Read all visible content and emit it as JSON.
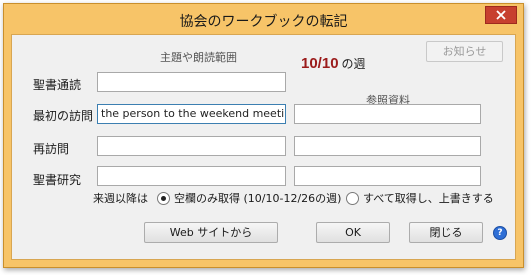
{
  "window": {
    "title": "協会のワークブックの転記"
  },
  "header": {
    "main_heading": "主題や朗読範囲",
    "week_number": "10/10",
    "week_suffix": "の週",
    "reference_heading": "参照資料",
    "notice_button": "お知らせ"
  },
  "rows": [
    {
      "label": "聖書通読",
      "main_value": "",
      "ref_value": null
    },
    {
      "label": "最初の訪問",
      "main_value": "the person to the weekend meeting!",
      "ref_value": ""
    },
    {
      "label": "再訪問",
      "main_value": "",
      "ref_value": ""
    },
    {
      "label": "聖書研究",
      "main_value": "",
      "ref_value": ""
    }
  ],
  "options": {
    "label": "来週以降は",
    "choices": [
      {
        "label": "空欄のみ取得 (10/10-12/26の週)",
        "selected": true
      },
      {
        "label": "すべて取得し、上書きする",
        "selected": false
      }
    ]
  },
  "buttons": {
    "web": "Web サイトから",
    "ok": "OK",
    "close": "閉じる"
  },
  "icons": {
    "close": "close-icon",
    "help": "help-icon"
  },
  "colors": {
    "frame": "#f7c468",
    "close_button": "#c7402f",
    "week_number": "#9b1b1b"
  }
}
